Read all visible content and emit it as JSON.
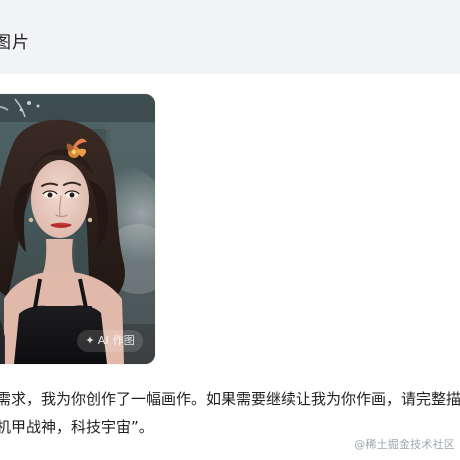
{
  "user_message": {
    "text": "图片"
  },
  "assistant": {
    "image": {
      "badge_text": "AI 作图"
    },
    "reply_lines": [
      "需求，我为你创作了一幅画作。如果需要继续让我为你作画，请完整描述",
      "机甲战神，科技宇宙”。"
    ]
  },
  "watermark": "@稀土掘金技术社区",
  "colors": {
    "page_bg": "#ffffff",
    "user_bubble_bg": "#f2f3f7",
    "text": "#222222",
    "watermark": "#8a93a6"
  }
}
